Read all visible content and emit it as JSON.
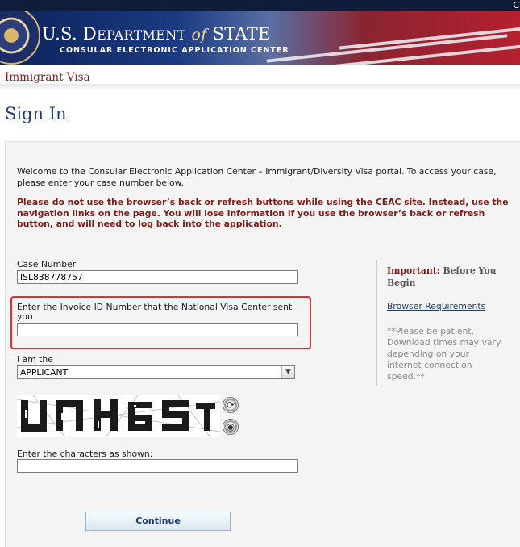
{
  "top_clip_text": "C",
  "header": {
    "department": "U.S. Department of State",
    "department_pre": "U.S. D",
    "department_mid": "EPARTMENT",
    "department_of": "of",
    "department_post": "STATE",
    "subtitle": "CONSULAR ELECTRONIC APPLICATION CENTER",
    "visa_type": "Immigrant Visa"
  },
  "page_title": "Sign In",
  "welcome_text": "Welcome to the Consular Electronic Application Center – Immigrant/Diversity Visa portal. To access your case, please enter your case number below.",
  "warning_text": "Please do not use the browser’s back or refresh buttons while using the CEAC site. Instead, use the navigation links on the page. You will lose information if you use the browser’s back or refresh button, and will need to log back into the application.",
  "form": {
    "case_number_label": "Case Number",
    "case_number_value": "ISL838778757",
    "invoice_label": "Enter the Invoice ID Number that the National Visa Center sent you",
    "invoice_value": "",
    "role_label": "I am the",
    "role_value": "APPLICANT",
    "captcha_text": "UNH6S",
    "captcha_label": "Enter the characters as shown:",
    "captcha_value": "",
    "continue_label": "Continue"
  },
  "sidebar": {
    "important_prefix": "Important:",
    "important_suffix": "Before You Begin",
    "browser_requirements": "Browser Requirements",
    "patience_text": "**Please be patient. Download times may vary depending on your internet connection speed.**"
  },
  "colors": {
    "title_blue": "#1d3c74",
    "warning_red": "#7c1b17",
    "highlight_red": "#e0303b"
  },
  "icons": {
    "refresh": "refresh-captcha-icon",
    "audio": "audio-captcha-icon",
    "seal": "state-department-seal-icon"
  }
}
